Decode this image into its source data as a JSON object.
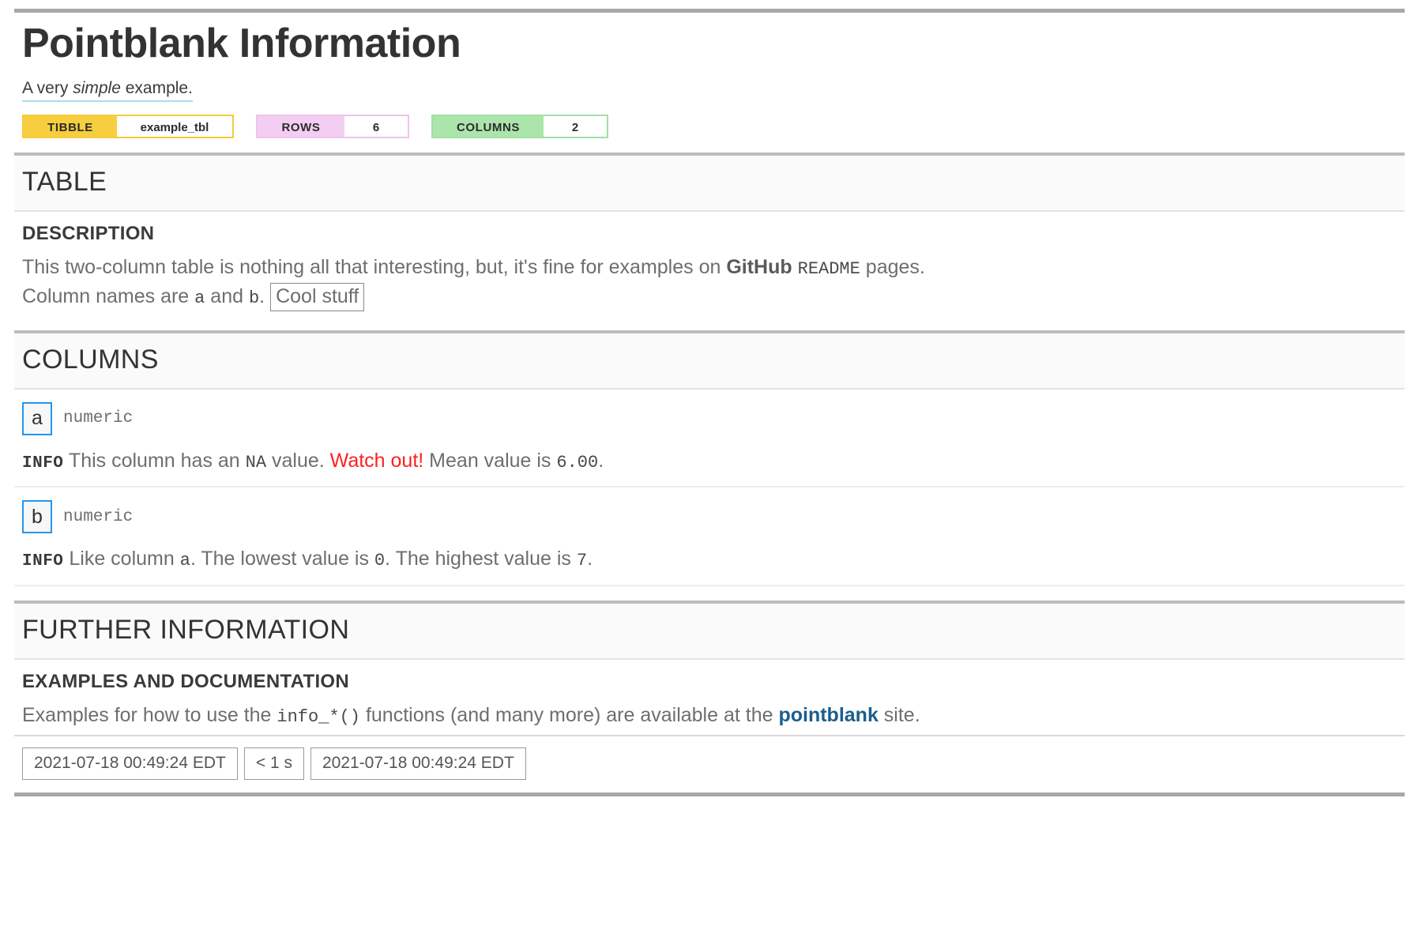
{
  "report": {
    "title": "Pointblank Information",
    "subtitle_prefix": "A very ",
    "subtitle_emphasis": "simple",
    "subtitle_suffix": " example."
  },
  "badges": {
    "tibble": {
      "label": "TIBBLE",
      "value": "example_tbl",
      "color": "#F7CE3D"
    },
    "rows": {
      "label": "ROWS",
      "value": "6",
      "color": "#F4CDF2"
    },
    "columns": {
      "label": "COLUMNS",
      "value": "2",
      "color": "#ABE5AB"
    }
  },
  "sections": {
    "table": {
      "heading": "TABLE",
      "description": {
        "heading": "DESCRIPTION",
        "line1_a": "This two-column table is nothing all that interesting, but, it's fine for examples on ",
        "line1_github": "GitHub",
        "line1_space": " ",
        "line1_readme": "README",
        "line1_b": " pages.",
        "line2_a": "Column names are ",
        "line2_col_a": "a",
        "line2_mid": " and ",
        "line2_col_b": "b",
        "line2_end": ". ",
        "line2_boxed": "Cool stuff"
      }
    },
    "columns": {
      "heading": "COLUMNS",
      "items": [
        {
          "name": "a",
          "type": "numeric",
          "info_tag": "INFO",
          "info_a": "This column has an ",
          "info_na": "NA",
          "info_b": " value. ",
          "info_warning": "Watch out!",
          "info_c": " Mean value is ",
          "info_value": "6.00",
          "info_d": "."
        },
        {
          "name": "b",
          "type": "numeric",
          "info_tag": "INFO",
          "info_a": "Like column ",
          "info_ref": "a",
          "info_b": ". The lowest value is ",
          "info_low": "0",
          "info_c": ". The highest value is ",
          "info_high": "7",
          "info_d": "."
        }
      ]
    },
    "further_information": {
      "heading": "FURTHER INFORMATION",
      "examples": {
        "heading": "EXAMPLES AND DOCUMENTATION",
        "text_a": "Examples for how to use the ",
        "code": "info_*()",
        "text_b": " functions (and many more) are available at the ",
        "link_label": "pointblank",
        "text_c": " site."
      }
    }
  },
  "footer": {
    "start_time": "2021-07-18 00:49:24 EDT",
    "duration": "< 1 s",
    "end_time": "2021-07-18 00:49:24 EDT"
  },
  "colors": {
    "accent_blue": "#2196F3",
    "link_blue": "#1B5E8C",
    "warning_red": "#FF1F1F",
    "underline_cyan": "#A8DCEC"
  }
}
